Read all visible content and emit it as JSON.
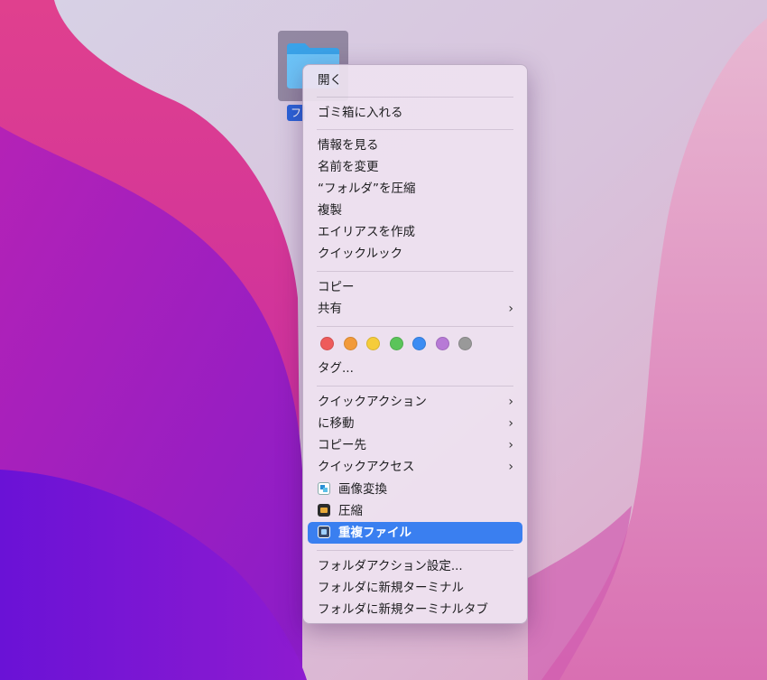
{
  "desktop": {
    "folder_label": "フ"
  },
  "menu": {
    "open": "開く",
    "trash": "ゴミ箱に入れる",
    "get_info": "情報を見る",
    "rename": "名前を変更",
    "compress": "“フォルダ”を圧縮",
    "duplicate": "複製",
    "make_alias": "エイリアスを作成",
    "quick_look": "クイックルック",
    "copy": "コピー",
    "share": "共有",
    "tags": "タグ...",
    "quick_actions": "クイックアクション",
    "move_to": "に移動",
    "copy_to": "コピー先",
    "quick_access": "クイックアクセス",
    "image_convert": "画像変換",
    "archive": "圧縮",
    "duplicate_files": "重複ファイル",
    "folder_action_setup": "フォルダアクション設定...",
    "new_terminal": "フォルダに新規ターミナル",
    "new_terminal_tab": "フォルダに新規ターミナルタブ",
    "submenu_glyph": "›"
  },
  "tag_colors": [
    "#ee5b5b",
    "#f29a3a",
    "#f5cc3a",
    "#5bc45a",
    "#3c8cf3",
    "#b77ad6",
    "#999999"
  ],
  "icons": {
    "folder": "folder-icon",
    "image_convert": "image-convert-icon",
    "archive": "archive-icon",
    "duplicate_files": "duplicate-files-icon"
  }
}
